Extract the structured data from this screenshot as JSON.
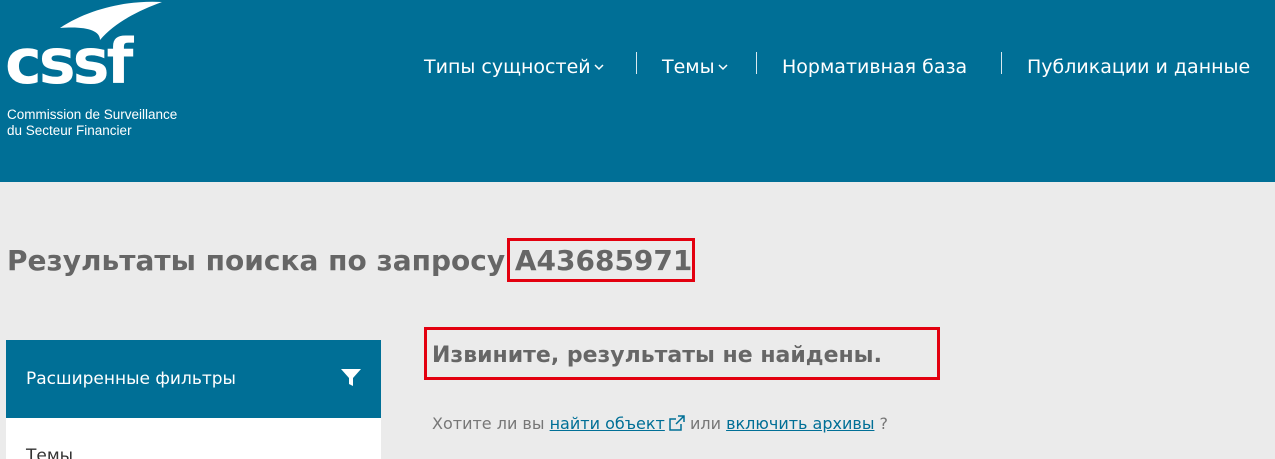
{
  "brand": {
    "logo_text": "cssf",
    "subtitle_line1": "Commission de Surveillance",
    "subtitle_line2": "du Secteur Financier"
  },
  "nav": {
    "items": [
      {
        "label": "Типы сущностей",
        "has_dropdown": true
      },
      {
        "label": "Темы",
        "has_dropdown": true
      },
      {
        "label": "Нормативная база",
        "has_dropdown": false
      },
      {
        "label": "Публикации и данные",
        "has_dropdown": false
      }
    ]
  },
  "search": {
    "title_prefix": "Результаты поиска по запросу",
    "query": "A43685971"
  },
  "filters": {
    "header": "Расширенные фильтры",
    "first_item": "Темы"
  },
  "results": {
    "no_results": "Извините, результаты не найдены.",
    "suggest_prefix": "Хотите ли вы",
    "find_entity_link": "найти объект",
    "or_text": "или",
    "include_archives_link": "включить архивы",
    "suffix": "?"
  },
  "colors": {
    "brand_blue": "#006f96",
    "highlight_red": "#e3000f",
    "background": "#ebebeb"
  }
}
